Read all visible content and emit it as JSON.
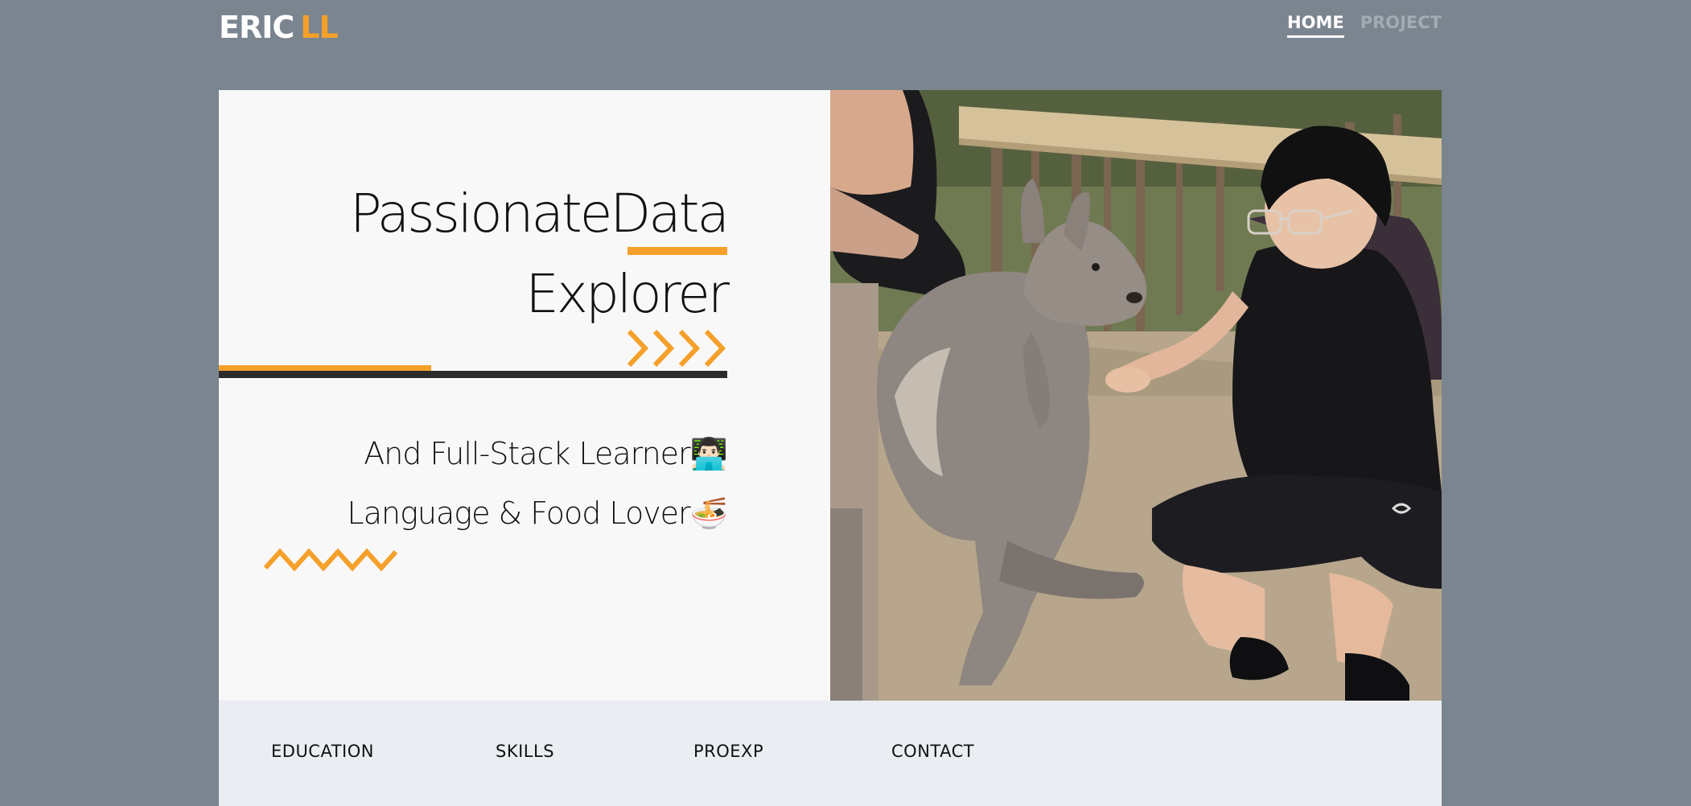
{
  "brand": {
    "first": "ERIC",
    "last": "LL"
  },
  "top_nav": {
    "home": "HOME",
    "project": "PROJECT"
  },
  "hero": {
    "headline_line1": "PassionateData",
    "headline_line2": "Explorer",
    "tagline_line1": "And Full-Stack Learner👨🏻‍💻",
    "tagline_line2": "Language & Food Lover🍜",
    "photo_icon": "kangaroo-feeding-photo"
  },
  "section_nav": {
    "education": "EDUCATION",
    "skills": "SKILLS",
    "proexp": "PROEXP",
    "contact": "CONTACT"
  },
  "colors": {
    "background": "#7b8590",
    "accent": "#f5a02a",
    "card": "#f8f8f8",
    "section_nav": "#eaeef2",
    "text": "#111111"
  }
}
